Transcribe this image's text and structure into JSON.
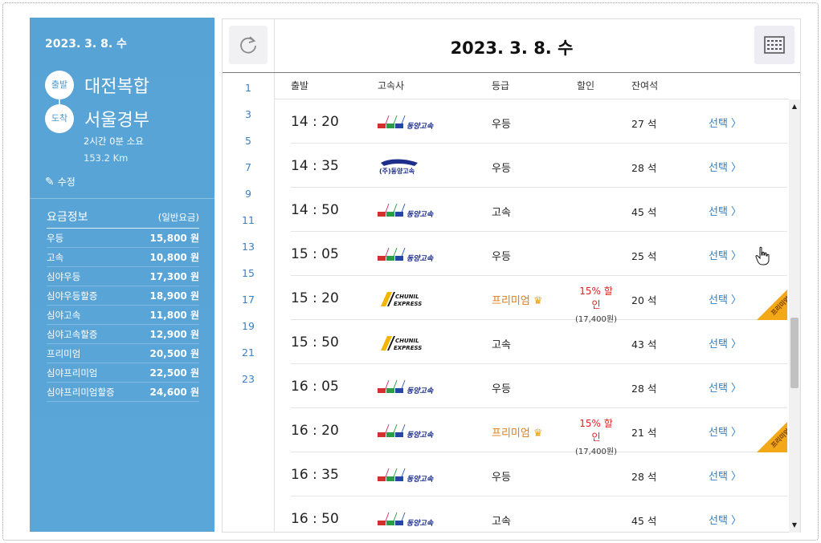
{
  "left": {
    "date": "2023. 3. 8. 수",
    "departure_label": "출발",
    "departure": "대전복합",
    "arrival_label": "도착",
    "arrival": "서울경부",
    "duration": "2시간 0분 소요",
    "distance": "153.2 Km",
    "edit_label": "수정",
    "fare_title": "요금정보",
    "fare_subtitle": "(일반요금)",
    "fares": [
      {
        "name": "우등",
        "price": "15,800 원"
      },
      {
        "name": "고속",
        "price": "10,800 원"
      },
      {
        "name": "심야우등",
        "price": "17,300 원"
      },
      {
        "name": "심야우등할증",
        "price": "18,900 원"
      },
      {
        "name": "심야고속",
        "price": "11,800 원"
      },
      {
        "name": "심야고속할증",
        "price": "12,900 원"
      },
      {
        "name": "프리미엄",
        "price": "20,500 원"
      },
      {
        "name": "심야프리미엄",
        "price": "22,500 원"
      },
      {
        "name": "심야프리미엄할증",
        "price": "24,600 원"
      }
    ]
  },
  "header": {
    "title": "2023. 3. 8. 수",
    "refresh_icon": "refresh-icon",
    "calendar_icon": "calendar-icon"
  },
  "hours": [
    "1",
    "3",
    "5",
    "7",
    "9",
    "11",
    "13",
    "15",
    "17",
    "19",
    "21",
    "23"
  ],
  "columns": {
    "departure": "출발",
    "company": "고속사",
    "grade": "등급",
    "discount": "할인",
    "seats": "잔여석"
  },
  "rows": [
    {
      "time": "14 : 20",
      "logo": "dongyang",
      "logo_text": "동양고속",
      "grade": "우등",
      "premium": false,
      "discount": "",
      "discount_price": "",
      "seats": "27 석",
      "select": "선택 〉"
    },
    {
      "time": "14 : 35",
      "logo": "dongyang-old",
      "logo_text": "(주)동양고속",
      "grade": "우등",
      "premium": false,
      "discount": "",
      "discount_price": "",
      "seats": "28 석",
      "select": "선택 〉"
    },
    {
      "time": "14 : 50",
      "logo": "dongyang",
      "logo_text": "동양고속",
      "grade": "고속",
      "premium": false,
      "discount": "",
      "discount_price": "",
      "seats": "45 석",
      "select": "선택 〉"
    },
    {
      "time": "15 : 05",
      "logo": "dongyang",
      "logo_text": "동양고속",
      "grade": "우등",
      "premium": false,
      "discount": "",
      "discount_price": "",
      "seats": "25 석",
      "select": "선택 〉"
    },
    {
      "time": "15 : 20",
      "logo": "chunil",
      "logo_text": "CHUNIL EXPRESS",
      "grade": "프리미엄",
      "premium": true,
      "discount": "15% 할인",
      "discount_price": "(17,400원)",
      "seats": "20 석",
      "select": "선택 〉",
      "ribbon": "프리미엄"
    },
    {
      "time": "15 : 50",
      "logo": "chunil",
      "logo_text": "CHUNIL EXPRESS",
      "grade": "고속",
      "premium": false,
      "discount": "",
      "discount_price": "",
      "seats": "43 석",
      "select": "선택 〉"
    },
    {
      "time": "16 : 05",
      "logo": "dongyang",
      "logo_text": "동양고속",
      "grade": "우등",
      "premium": false,
      "discount": "",
      "discount_price": "",
      "seats": "28 석",
      "select": "선택 〉"
    },
    {
      "time": "16 : 20",
      "logo": "dongyang",
      "logo_text": "동양고속",
      "grade": "프리미엄",
      "premium": true,
      "discount": "15% 할인",
      "discount_price": "(17,400원)",
      "seats": "21 석",
      "select": "선택 〉",
      "ribbon": "프리미엄"
    },
    {
      "time": "16 : 35",
      "logo": "dongyang",
      "logo_text": "동양고속",
      "grade": "우등",
      "premium": false,
      "discount": "",
      "discount_price": "",
      "seats": "28 석",
      "select": "선택 〉"
    },
    {
      "time": "16 : 50",
      "logo": "dongyang",
      "logo_text": "동양고속",
      "grade": "고속",
      "premium": false,
      "discount": "",
      "discount_price": "",
      "seats": "45 석",
      "select": "선택 〉"
    }
  ],
  "colors": {
    "panel_blue": "#5aa6d8",
    "link_blue": "#2f7fc7",
    "premium_orange": "#e07a12",
    "discount_red": "#dd2222",
    "ribbon_gold": "#f3a817"
  }
}
